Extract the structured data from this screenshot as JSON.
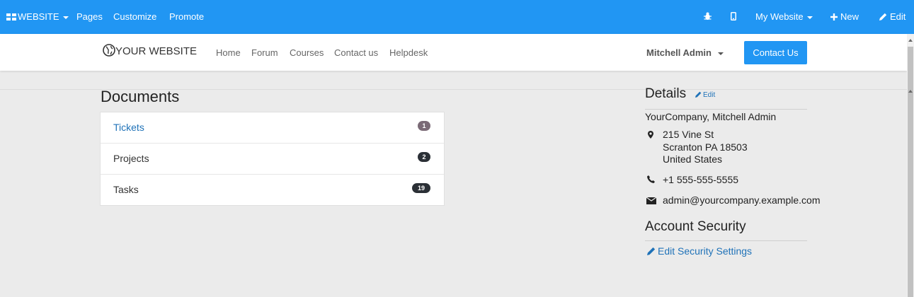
{
  "adminbar": {
    "app_menu": "WEBSITE",
    "pages": "Pages",
    "customize": "Customize",
    "promote": "Promote",
    "website_selector": "My Website",
    "new": "New",
    "edit": "Edit"
  },
  "navbar": {
    "logo": "YOUR WEBSITE",
    "links": [
      "Home",
      "Forum",
      "Courses",
      "Contact us",
      "Helpdesk"
    ],
    "user": "Mitchell Admin",
    "contact_button": "Contact Us"
  },
  "documents": {
    "title": "Documents",
    "items": [
      {
        "label": "Tickets",
        "count": "1"
      },
      {
        "label": "Projects",
        "count": "2"
      },
      {
        "label": "Tasks",
        "count": "19"
      }
    ]
  },
  "details": {
    "title": "Details",
    "edit": "Edit",
    "company": "YourCompany, Mitchell Admin",
    "address": [
      "215 Vine St",
      "Scranton PA 18503",
      "United States"
    ],
    "phone": "+1 555-555-5555",
    "email": "admin@yourcompany.example.com"
  },
  "security": {
    "title": "Account Security",
    "edit_link": "Edit Security Settings"
  },
  "colors": {
    "primary": "#2196f3",
    "link": "#1f72b8",
    "badge_tickets": "#7a6a76",
    "badge_dark": "#2b3036"
  }
}
